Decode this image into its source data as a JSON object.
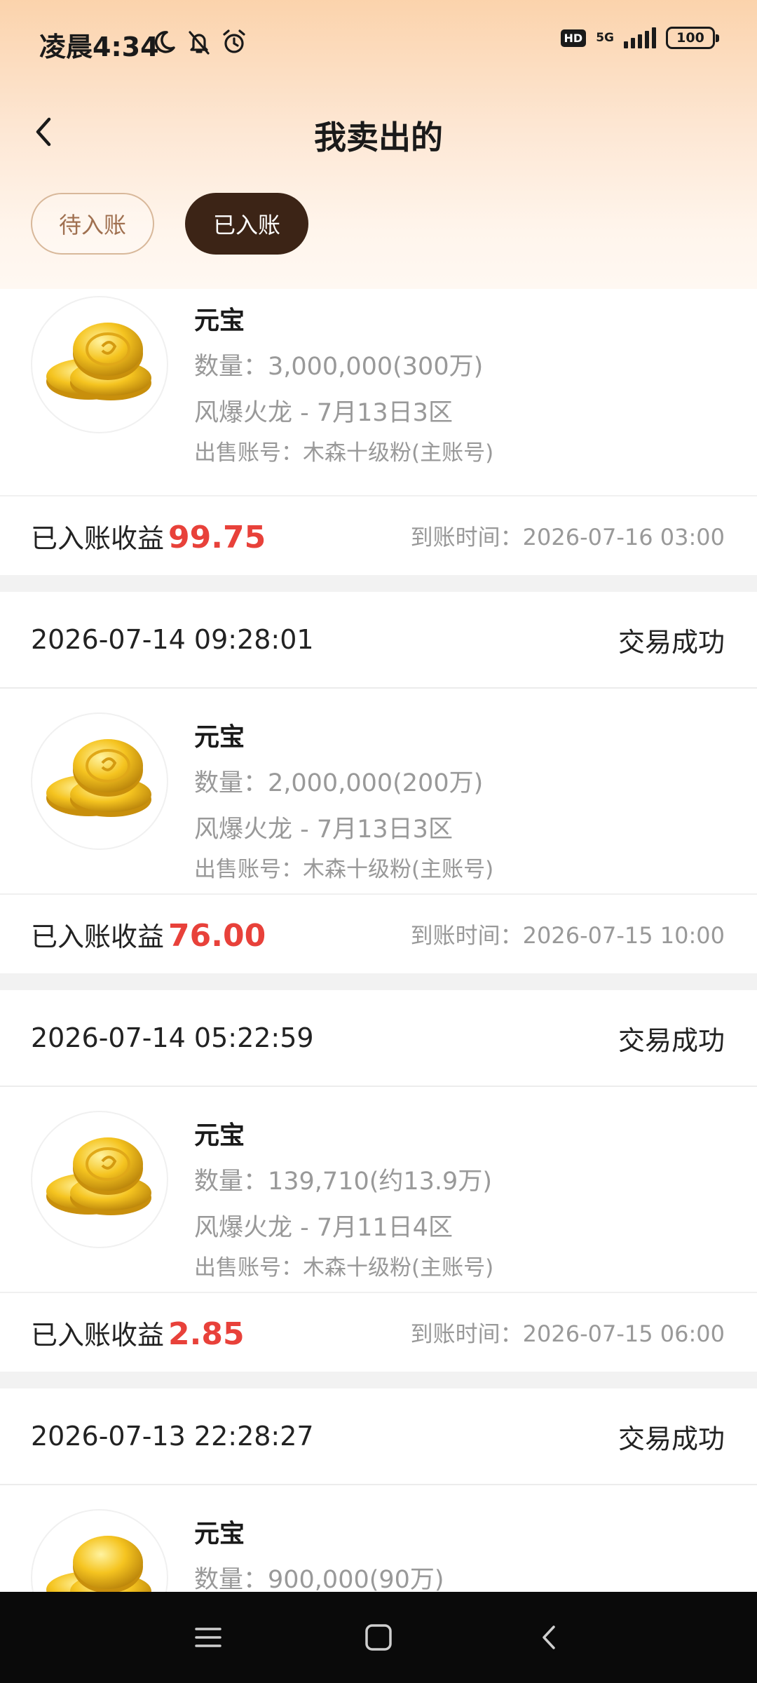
{
  "status_bar": {
    "time": "凌晨4:34",
    "hd": "HD",
    "network": "5G",
    "battery": "100"
  },
  "header": {
    "title": "我卖出的"
  },
  "tabs": [
    {
      "label": "待入账",
      "active": false
    },
    {
      "label": "已入账",
      "active": true
    }
  ],
  "orders": [
    {
      "item": "元宝",
      "quantity": "数量：3,000,000(300万)",
      "server": "风爆火龙 - 7月13日3区",
      "account": "出售账号：木森十级粉(主账号)",
      "earn_label": "已入账收益",
      "earn_value": "99.75",
      "arrival": "到账时间：2026-07-16 03:00"
    },
    {
      "datetime": "2026-07-14 09:28:01",
      "status": "交易成功",
      "item": "元宝",
      "quantity": "数量：2,000,000(200万)",
      "server": "风爆火龙 - 7月13日3区",
      "account": "出售账号：木森十级粉(主账号)",
      "earn_label": "已入账收益",
      "earn_value": "76.00",
      "arrival": "到账时间：2026-07-15 10:00"
    },
    {
      "datetime": "2026-07-14 05:22:59",
      "status": "交易成功",
      "item": "元宝",
      "quantity": "数量：139,710(约13.9万)",
      "server": "风爆火龙 - 7月11日4区",
      "account": "出售账号：木森十级粉(主账号)",
      "earn_label": "已入账收益",
      "earn_value": "2.85",
      "arrival": "到账时间：2026-07-15 06:00"
    },
    {
      "datetime": "2026-07-13 22:28:27",
      "status": "交易成功",
      "item": "元宝",
      "quantity": "数量：900,000(90万)"
    }
  ],
  "colors": {
    "accent_red": "#e8413a",
    "active_tab": "#3c2416",
    "gradient_top": "#fbd3ac"
  },
  "icons": [
    "moon-icon",
    "bell-off-icon",
    "alarm-icon",
    "signal-icon",
    "battery-icon",
    "back-arrow-icon",
    "coin-icon",
    "menu-icon",
    "home-icon",
    "nav-back-icon"
  ]
}
